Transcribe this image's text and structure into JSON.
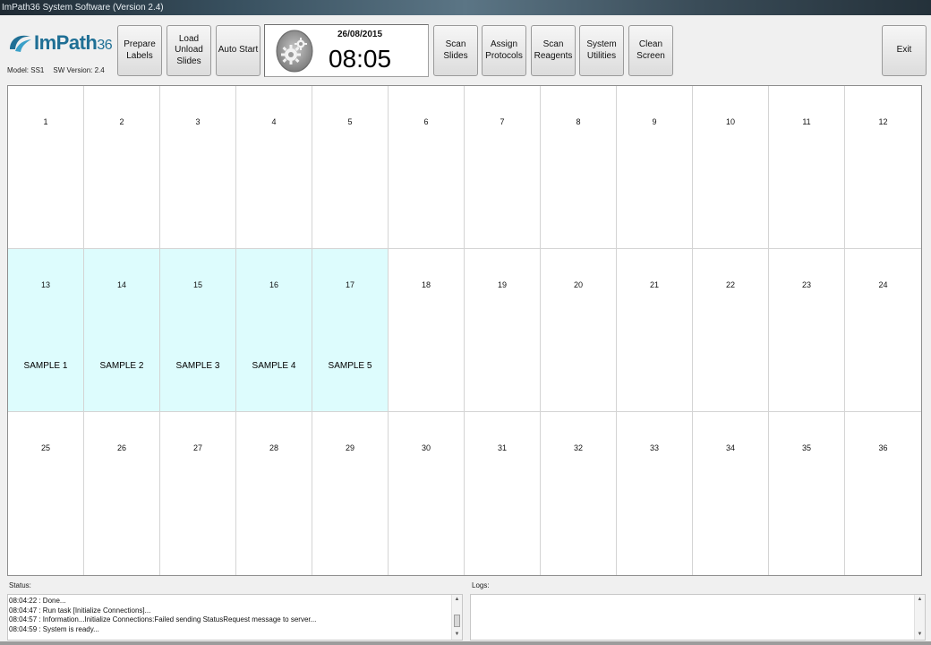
{
  "window": {
    "title": "ImPath36 System Software (Version 2.4)"
  },
  "brand": {
    "logo_main": "ImPath",
    "logo_num": "36",
    "model": "Model: SS1",
    "sw_version": "SW Version: 2.4"
  },
  "toolbar": {
    "prepare_labels": "Prepare\nLabels",
    "load_unload_slides": "Load\nUnload\nSlides",
    "auto_start": "Auto Start",
    "scan_slides": "Scan\nSlides",
    "assign_protocols": "Assign\nProtocols",
    "scan_reagents": "Scan\nReagents",
    "system_utilities": "System\nUtilities",
    "clean_screen": "Clean\nScreen",
    "exit": "Exit"
  },
  "clock": {
    "date": "26/08/2015",
    "time": "08:05",
    "status_icon": "gears-icon"
  },
  "slots": [
    {
      "num": "1",
      "sample": ""
    },
    {
      "num": "2",
      "sample": ""
    },
    {
      "num": "3",
      "sample": ""
    },
    {
      "num": "4",
      "sample": ""
    },
    {
      "num": "5",
      "sample": ""
    },
    {
      "num": "6",
      "sample": ""
    },
    {
      "num": "7",
      "sample": ""
    },
    {
      "num": "8",
      "sample": ""
    },
    {
      "num": "9",
      "sample": ""
    },
    {
      "num": "10",
      "sample": ""
    },
    {
      "num": "11",
      "sample": ""
    },
    {
      "num": "12",
      "sample": ""
    },
    {
      "num": "13",
      "sample": "SAMPLE 1"
    },
    {
      "num": "14",
      "sample": "SAMPLE 2"
    },
    {
      "num": "15",
      "sample": "SAMPLE 3"
    },
    {
      "num": "16",
      "sample": "SAMPLE 4"
    },
    {
      "num": "17",
      "sample": "SAMPLE 5"
    },
    {
      "num": "18",
      "sample": ""
    },
    {
      "num": "19",
      "sample": ""
    },
    {
      "num": "20",
      "sample": ""
    },
    {
      "num": "21",
      "sample": ""
    },
    {
      "num": "22",
      "sample": ""
    },
    {
      "num": "23",
      "sample": ""
    },
    {
      "num": "24",
      "sample": ""
    },
    {
      "num": "25",
      "sample": ""
    },
    {
      "num": "26",
      "sample": ""
    },
    {
      "num": "27",
      "sample": ""
    },
    {
      "num": "28",
      "sample": ""
    },
    {
      "num": "29",
      "sample": ""
    },
    {
      "num": "30",
      "sample": ""
    },
    {
      "num": "31",
      "sample": ""
    },
    {
      "num": "32",
      "sample": ""
    },
    {
      "num": "33",
      "sample": ""
    },
    {
      "num": "34",
      "sample": ""
    },
    {
      "num": "35",
      "sample": ""
    },
    {
      "num": "36",
      "sample": ""
    }
  ],
  "status": {
    "label": "Status:",
    "lines": [
      "08:04:22 : Done...",
      "08:04:47 : Run task [Initialize Connections]...",
      "08:04:57 : Information...Initialize Connections:Failed sending StatusRequest message to server...",
      "08:04:59 : System is ready..."
    ]
  },
  "logs": {
    "label": "Logs:"
  },
  "colors": {
    "loaded_slot": "#ddfcfd",
    "logo_blue": "#1f6f95"
  }
}
